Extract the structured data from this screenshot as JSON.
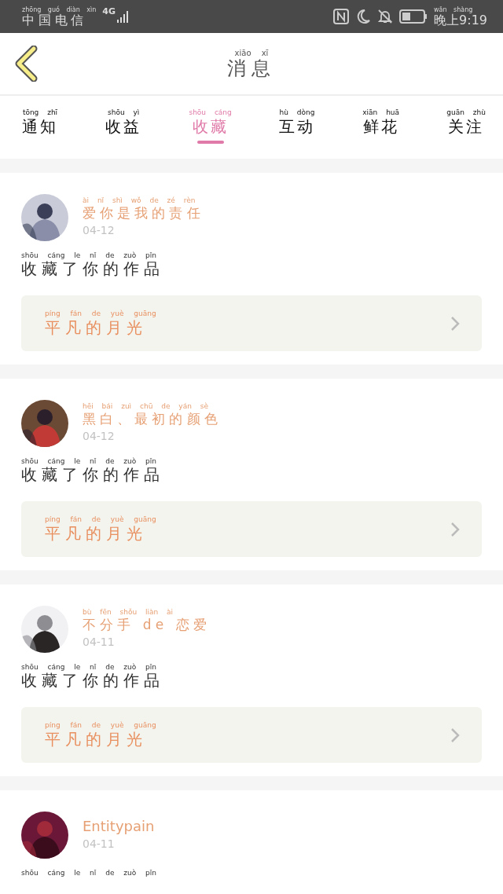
{
  "status_bar": {
    "carrier": "中国电信",
    "carrier_pinyin": "zhōng guó diàn xìn",
    "network": "4G",
    "time": "晚上9:19",
    "time_pinyin": "wǎn shàng"
  },
  "header": {
    "title": "消息",
    "title_pinyin": "xiāo xī"
  },
  "tabs": [
    {
      "label": "通知",
      "pinyin": "tōng zhī",
      "selected": false
    },
    {
      "label": "收益",
      "pinyin": "shōu yì",
      "selected": false
    },
    {
      "label": "收藏",
      "pinyin": "shōu cáng",
      "selected": true
    },
    {
      "label": "互动",
      "pinyin": "hù dòng",
      "selected": false
    },
    {
      "label": "鲜花",
      "pinyin": "xiān huā",
      "selected": false
    },
    {
      "label": "关注",
      "pinyin": "guān zhù",
      "selected": false
    }
  ],
  "messages": [
    {
      "name": "爱你是我的责任",
      "name_pinyin": "ài nǐ shì wǒ de zé rèn",
      "date": "04-12",
      "text": "收藏了你的作品",
      "text_pinyin": "shōu cáng le nǐ de zuò pǐn",
      "work": "平凡的月光",
      "work_pinyin": "píng fán de yuè guāng"
    },
    {
      "name": "黑白、最初的颜色",
      "name_pinyin": "hēi bái zuì chū de yán sè",
      "date": "04-12",
      "text": "收藏了你的作品",
      "text_pinyin": "shōu cáng le nǐ de zuò pǐn",
      "work": "平凡的月光",
      "work_pinyin": "píng fán de yuè guāng"
    },
    {
      "name": "不分手 de 恋爱",
      "name_pinyin": "bù fēn shǒu liàn ài",
      "date": "04-11",
      "text": "收藏了你的作品",
      "text_pinyin": "shōu cáng le nǐ de zuò pǐn",
      "work": "平凡的月光",
      "work_pinyin": "píng fán de yuè guāng"
    },
    {
      "name": "Entitypain",
      "date": "04-11",
      "text_pinyin": "shōu cáng le nǐ de zuò pǐn"
    }
  ]
}
